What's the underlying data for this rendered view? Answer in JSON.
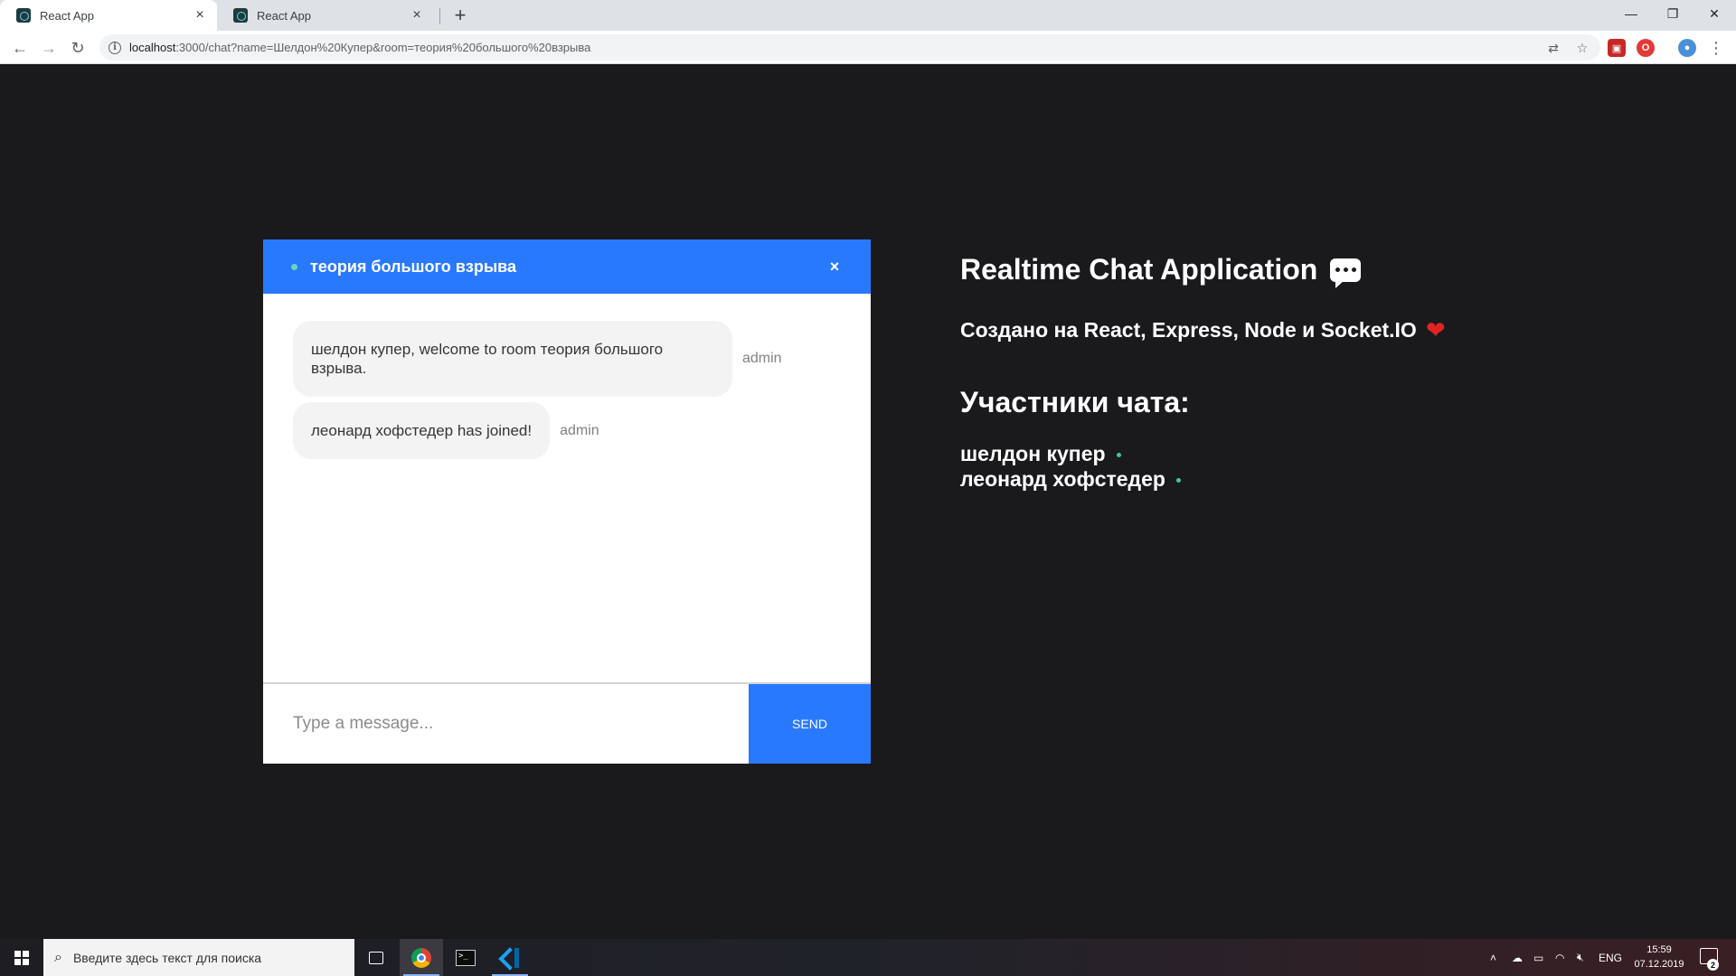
{
  "browser": {
    "tabs": [
      {
        "title": "React App",
        "active": true
      },
      {
        "title": "React App",
        "active": false
      }
    ],
    "url_host": "localhost",
    "url_rest": ":3000/chat?name=Шелдон%20Купер&room=теория%20большого%20взрыва"
  },
  "chat": {
    "room": "теория большого взрыва",
    "close_label": "×",
    "messages": [
      {
        "text": "шелдон купер, welcome to room теория большого взрыва.",
        "sender": "admin"
      },
      {
        "text": "леонард хофстедер has joined!",
        "sender": "admin"
      }
    ],
    "input_placeholder": "Type a message...",
    "send_label": "SEND"
  },
  "info": {
    "title": "Realtime Chat Application",
    "subtitle": "Создано на React, Express, Node и Socket.IO",
    "participants_title": "Участники чата:",
    "participants": [
      "шелдон купер",
      "леонард хофстедер"
    ]
  },
  "taskbar": {
    "search_placeholder": "Введите здесь текст для поиска",
    "language": "ENG",
    "time": "15:59",
    "date": "07.12.2019",
    "notifications": "2"
  }
}
